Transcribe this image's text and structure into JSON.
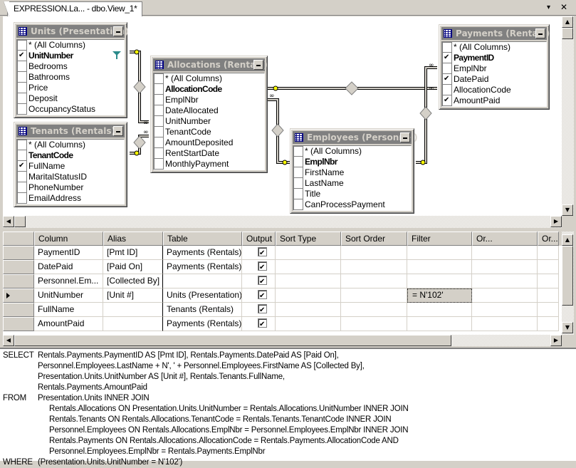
{
  "tab": {
    "title": "EXPRESSION.La... - dbo.View_1*",
    "dropdown_icon": "▾",
    "close_icon": "✕"
  },
  "tables": [
    {
      "id": "units",
      "title": "Units (Presentation)",
      "columns": [
        {
          "name": "* (All Columns)",
          "checked": false,
          "pk": false
        },
        {
          "name": "UnitNumber",
          "checked": true,
          "pk": true,
          "filtered": true
        },
        {
          "name": "Bedrooms",
          "checked": false,
          "pk": false
        },
        {
          "name": "Bathrooms",
          "checked": false,
          "pk": false
        },
        {
          "name": "Price",
          "checked": false,
          "pk": false
        },
        {
          "name": "Deposit",
          "checked": false,
          "pk": false
        },
        {
          "name": "OccupancyStatus",
          "checked": false,
          "pk": false
        }
      ]
    },
    {
      "id": "tenants",
      "title": "Tenants (Rentals)",
      "columns": [
        {
          "name": "* (All Columns)",
          "checked": false,
          "pk": false
        },
        {
          "name": "TenantCode",
          "checked": false,
          "pk": true
        },
        {
          "name": "FullName",
          "checked": true,
          "pk": false
        },
        {
          "name": "MaritalStatusID",
          "checked": false,
          "pk": false
        },
        {
          "name": "PhoneNumber",
          "checked": false,
          "pk": false
        },
        {
          "name": "EmailAddress",
          "checked": false,
          "pk": false
        }
      ]
    },
    {
      "id": "allocations",
      "title": "Allocations (Rentals)",
      "columns": [
        {
          "name": "* (All Columns)",
          "checked": false,
          "pk": false
        },
        {
          "name": "AllocationCode",
          "checked": false,
          "pk": true
        },
        {
          "name": "EmplNbr",
          "checked": false,
          "pk": false
        },
        {
          "name": "DateAllocated",
          "checked": false,
          "pk": false
        },
        {
          "name": "UnitNumber",
          "checked": false,
          "pk": false
        },
        {
          "name": "TenantCode",
          "checked": false,
          "pk": false
        },
        {
          "name": "AmountDeposited",
          "checked": false,
          "pk": false
        },
        {
          "name": "RentStartDate",
          "checked": false,
          "pk": false
        },
        {
          "name": "MonthlyPayment",
          "checked": false,
          "pk": false
        }
      ]
    },
    {
      "id": "employees",
      "title": "Employees (Personnel)",
      "columns": [
        {
          "name": "* (All Columns)",
          "checked": false,
          "pk": false
        },
        {
          "name": "EmplNbr",
          "checked": false,
          "pk": true
        },
        {
          "name": "FirstName",
          "checked": false,
          "pk": false
        },
        {
          "name": "LastName",
          "checked": false,
          "pk": false
        },
        {
          "name": "Title",
          "checked": false,
          "pk": false
        },
        {
          "name": "CanProcessPayment",
          "checked": false,
          "pk": false
        }
      ]
    },
    {
      "id": "payments",
      "title": "Payments (Rentals)",
      "columns": [
        {
          "name": "* (All Columns)",
          "checked": false,
          "pk": false
        },
        {
          "name": "PaymentID",
          "checked": true,
          "pk": true
        },
        {
          "name": "EmplNbr",
          "checked": false,
          "pk": false
        },
        {
          "name": "DatePaid",
          "checked": true,
          "pk": false
        },
        {
          "name": "AllocationCode",
          "checked": false,
          "pk": false
        },
        {
          "name": "AmountPaid",
          "checked": true,
          "pk": false
        }
      ]
    }
  ],
  "grid": {
    "headers": [
      "",
      "Column",
      "Alias",
      "Table",
      "Output",
      "Sort Type",
      "Sort Order",
      "Filter",
      "Or...",
      "Or..."
    ],
    "rows": [
      {
        "column": "PaymentID",
        "alias": "[Pmt ID]",
        "table": "Payments (Rentals)",
        "output": true,
        "sort_type": "",
        "sort_order": "",
        "filter": "",
        "or1": "",
        "or2": "",
        "current": false
      },
      {
        "column": "DatePaid",
        "alias": "[Paid On]",
        "table": "Payments (Rentals)",
        "output": true,
        "sort_type": "",
        "sort_order": "",
        "filter": "",
        "or1": "",
        "or2": "",
        "current": false
      },
      {
        "column": "Personnel.Em...",
        "alias": "[Collected By]",
        "table": "",
        "output": true,
        "sort_type": "",
        "sort_order": "",
        "filter": "",
        "or1": "",
        "or2": "",
        "current": false
      },
      {
        "column": "UnitNumber",
        "alias": "[Unit #]",
        "table": "Units (Presentation)",
        "output": true,
        "sort_type": "",
        "sort_order": "",
        "filter": "= N'102'",
        "or1": "",
        "or2": "",
        "current": true
      },
      {
        "column": "FullName",
        "alias": "",
        "table": "Tenants (Rentals)",
        "output": true,
        "sort_type": "",
        "sort_order": "",
        "filter": "",
        "or1": "",
        "or2": "",
        "current": false
      },
      {
        "column": "AmountPaid",
        "alias": "",
        "table": "Payments (Rentals)",
        "output": true,
        "sort_type": "",
        "sort_order": "",
        "filter": "",
        "or1": "",
        "or2": "",
        "current": false
      }
    ]
  },
  "sql": [
    {
      "kw": "SELECT",
      "indent": 1,
      "text": "Rentals.Payments.PaymentID AS [Pmt ID], Rentals.Payments.DatePaid AS [Paid On],"
    },
    {
      "kw": "",
      "indent": 1,
      "text": "Personnel.Employees.LastName + N', ' + Personnel.Employees.FirstName AS [Collected By],"
    },
    {
      "kw": "",
      "indent": 1,
      "text": "Presentation.Units.UnitNumber AS [Unit #], Rentals.Tenants.FullName,"
    },
    {
      "kw": "",
      "indent": 1,
      "text": "Rentals.Payments.AmountPaid"
    },
    {
      "kw": "FROM",
      "indent": 1,
      "text": "Presentation.Units INNER JOIN"
    },
    {
      "kw": "",
      "indent": 2,
      "text": "Rentals.Allocations ON Presentation.Units.UnitNumber = Rentals.Allocations.UnitNumber INNER JOIN"
    },
    {
      "kw": "",
      "indent": 2,
      "text": "Rentals.Tenants ON Rentals.Allocations.TenantCode = Rentals.Tenants.TenantCode INNER JOIN"
    },
    {
      "kw": "",
      "indent": 2,
      "text": "Personnel.Employees ON Rentals.Allocations.EmplNbr = Personnel.Employees.EmplNbr INNER JOIN"
    },
    {
      "kw": "",
      "indent": 2,
      "text": "Rentals.Payments ON Rentals.Allocations.AllocationCode = Rentals.Payments.AllocationCode AND"
    },
    {
      "kw": "",
      "indent": 2,
      "text": "Personnel.Employees.EmplNbr = Rentals.Payments.EmplNbr"
    },
    {
      "kw": "WHERE",
      "indent": 1,
      "text": "(Presentation.Units.UnitNumber = N'102')"
    }
  ]
}
